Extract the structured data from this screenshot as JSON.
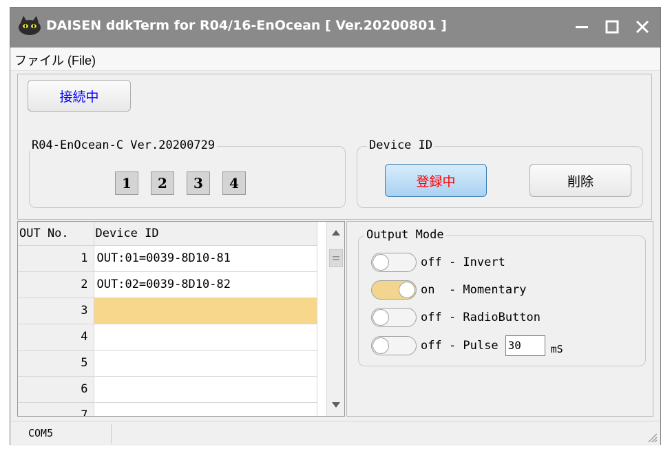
{
  "window": {
    "title": "DAISEN ddkTerm for R04/16-EnOcean [ Ver.20200801 ]",
    "icon": "cat-icon",
    "controls": [
      "minimize-icon",
      "maximize-icon",
      "close-icon"
    ]
  },
  "menu": {
    "file_label": "ファイル (File)"
  },
  "connection": {
    "button_label": "接続中"
  },
  "version_group": {
    "legend": "R04-EnOcean-C Ver.20200729",
    "indicators": [
      "1",
      "2",
      "3",
      "4"
    ]
  },
  "device_group": {
    "legend": "Device ID",
    "register_label": "登録中",
    "delete_label": "削除"
  },
  "grid": {
    "col_num": "OUT No.",
    "col_device": "Device ID",
    "rows": [
      {
        "num": "1",
        "device": "OUT:01=0039-8D10-81"
      },
      {
        "num": "2",
        "device": "OUT:02=0039-8D10-82"
      },
      {
        "num": "3",
        "device": ""
      },
      {
        "num": "4",
        "device": ""
      },
      {
        "num": "5",
        "device": ""
      },
      {
        "num": "6",
        "device": ""
      },
      {
        "num": "7",
        "device": ""
      }
    ],
    "selected_row": 3
  },
  "output_mode": {
    "legend": "Output Mode",
    "rows": [
      {
        "state": "off",
        "label": "off - Invert"
      },
      {
        "state": "on",
        "label": "on  - Momentary"
      },
      {
        "state": "off",
        "label": "off - RadioButton"
      },
      {
        "state": "off",
        "label": "off - Pulse"
      }
    ],
    "pulse_value": "30",
    "pulse_unit": "mS"
  },
  "status": {
    "port": "COM5"
  },
  "colors": {
    "titlebar": "#8a8a8a",
    "connect_text": "#0000ff",
    "register_text": "#ff0000",
    "selected_row": "#f7d78c",
    "toggle_on": "#f2d58f"
  }
}
